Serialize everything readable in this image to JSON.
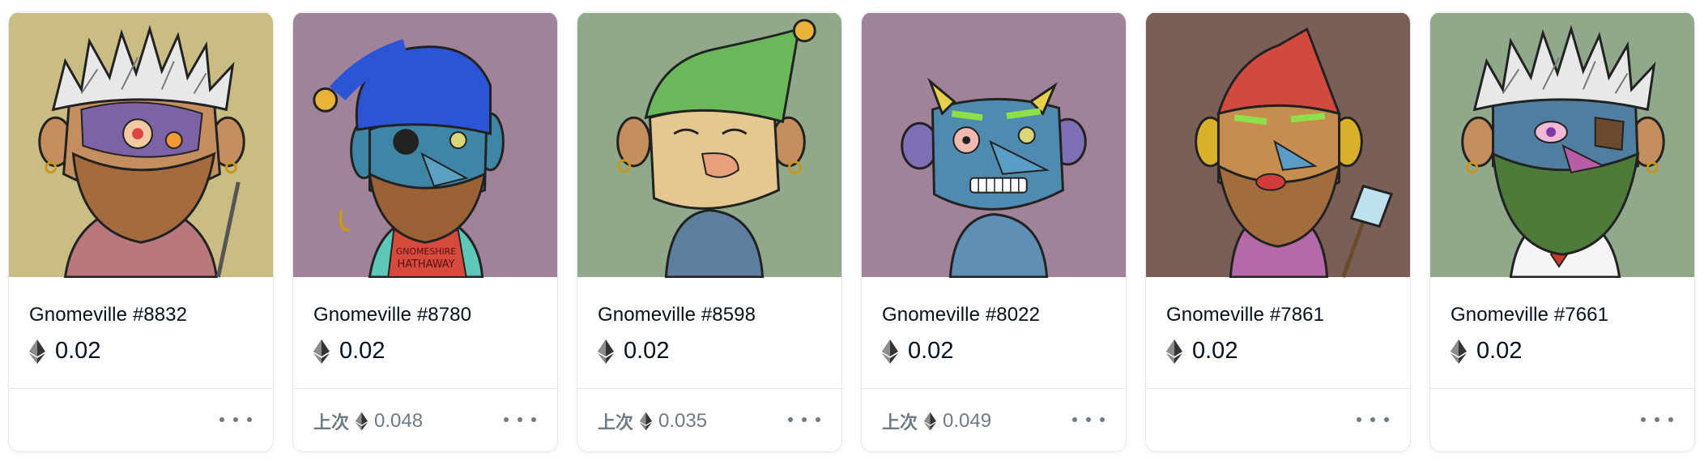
{
  "cards": [
    {
      "name": "Gnomeville #8832",
      "price": "0.02",
      "last_label": "",
      "last_price": "",
      "bg": "#c9bd83",
      "hat": "spiky-white",
      "skin": "#c48e5e",
      "beard": "#a56b3f"
    },
    {
      "name": "Gnomeville #8780",
      "price": "0.02",
      "last_label": "上次",
      "last_price": "0.048",
      "bg": "#a08398",
      "hat": "#2b55d6",
      "skin": "#3f86a6",
      "beard": "#9a6236",
      "shirt_text": "GNOMESHIRE HATHAWAY"
    },
    {
      "name": "Gnomeville #8598",
      "price": "0.02",
      "last_label": "上次",
      "last_price": "0.035",
      "bg": "#8fa98a",
      "hat": "#6bb85a",
      "skin": "#e5c890",
      "beard": "none"
    },
    {
      "name": "Gnomeville #8022",
      "price": "0.02",
      "last_label": "上次",
      "last_price": "0.049",
      "bg": "#a08398",
      "hat": "horns",
      "skin": "#4f8ab0",
      "beard": "none"
    },
    {
      "name": "Gnomeville #7861",
      "price": "0.02",
      "last_label": "",
      "last_price": "",
      "bg": "#7b5f57",
      "hat": "#d24a3e",
      "skin": "#c78d4f",
      "beard": "#a26c3d"
    },
    {
      "name": "Gnomeville #7661",
      "price": "0.02",
      "last_label": "",
      "last_price": "",
      "bg": "#8fa98a",
      "hat": "spiky-white",
      "skin": "#c48e5e",
      "beard": "#4e7a3a"
    }
  ],
  "icons": {
    "currency": "ethereum-icon",
    "more": "more-options-icon"
  }
}
